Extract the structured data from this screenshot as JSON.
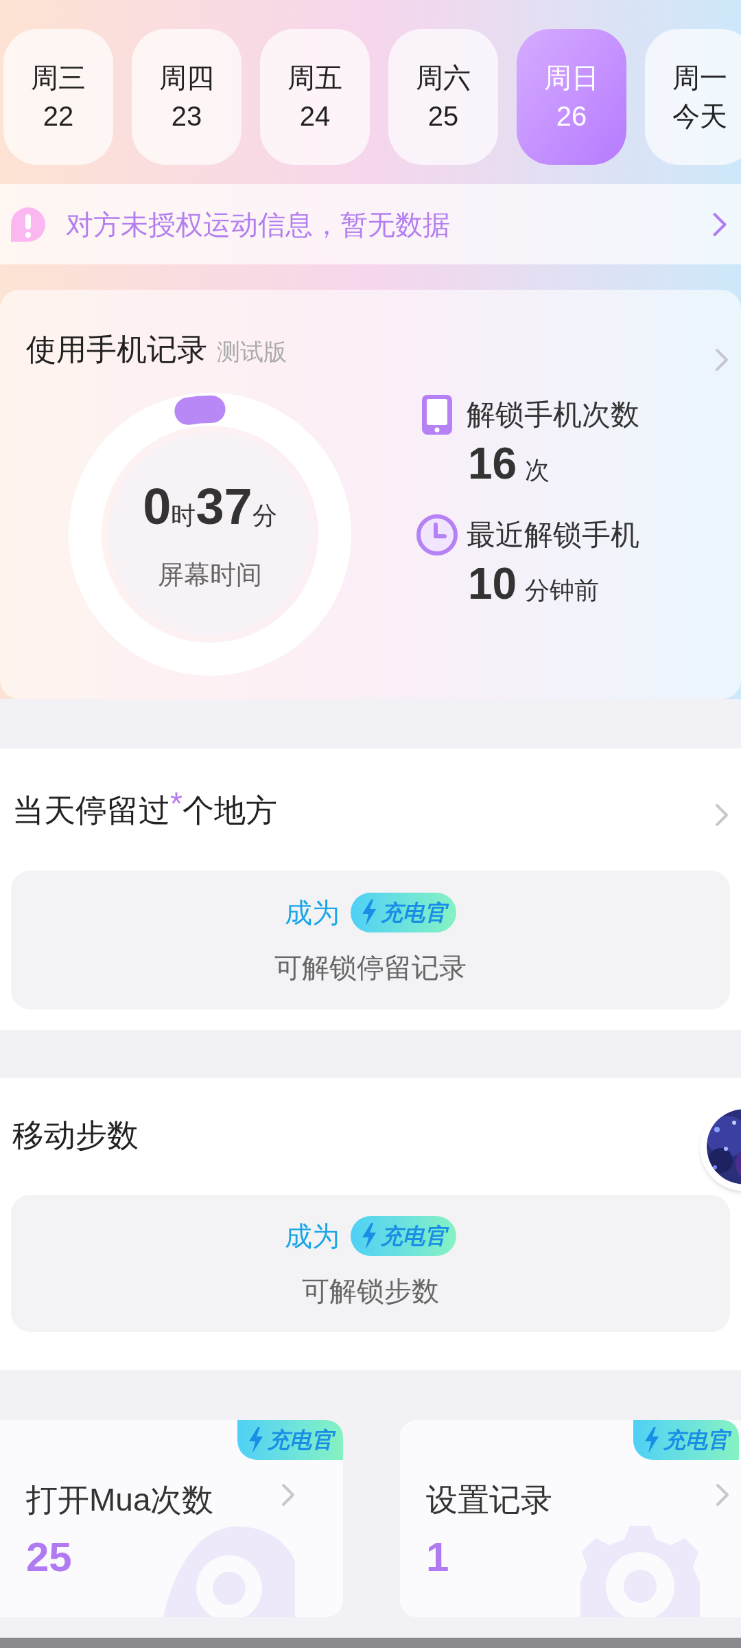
{
  "date_tabs": [
    {
      "weekday": "周三",
      "date": "22",
      "selected": false
    },
    {
      "weekday": "周四",
      "date": "23",
      "selected": false
    },
    {
      "weekday": "周五",
      "date": "24",
      "selected": false
    },
    {
      "weekday": "周六",
      "date": "25",
      "selected": false
    },
    {
      "weekday": "周日",
      "date": "26",
      "selected": true
    },
    {
      "weekday": "周一",
      "date": "今天",
      "selected": false
    }
  ],
  "notice": {
    "text": "对方未授权运动信息，暂无数据"
  },
  "phone_usage": {
    "title": "使用手机记录",
    "tag": "测试版",
    "screen_time": {
      "hours": "0",
      "hours_unit": "时",
      "minutes": "37",
      "minutes_unit": "分",
      "label": "屏幕时间",
      "level": 0.03
    },
    "stats": [
      {
        "kind": "unlock_count",
        "label": "解锁手机次数",
        "value": "16",
        "unit": "次"
      },
      {
        "kind": "last_unlock",
        "label": "最近解锁手机",
        "value": "10",
        "unit": "分钟前"
      }
    ]
  },
  "places": {
    "title": "当天停留过$^{*}$个地方",
    "lock": {
      "prefix": "成为",
      "badge": "充电官",
      "text": "可解锁停留记录"
    }
  },
  "steps": {
    "title": "移动步数",
    "lock": {
      "prefix": "成为",
      "badge": "充电官",
      "text": "可解锁步数"
    }
  },
  "stat_cards": [
    {
      "kind": "eye",
      "title": "打开Mua次数",
      "value": "25",
      "badge": "充电官"
    },
    {
      "kind": "gear",
      "title": "设置记录",
      "value": "1",
      "badge": "充电官"
    }
  ]
}
